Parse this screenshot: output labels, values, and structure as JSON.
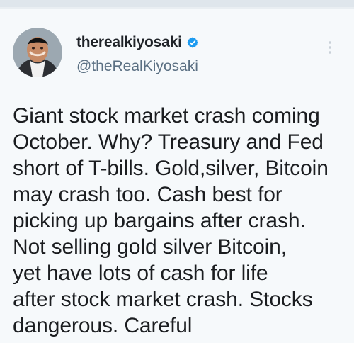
{
  "tweet": {
    "display_name": "therealkiyosaki",
    "handle": "@theRealKiyosaki",
    "verified": true,
    "text_lines": [
      "Giant stock market crash coming",
      "October. Why?  Treasury and Fed",
      "short of T-bills. Gold,silver, Bitcoin",
      "may crash too. Cash best for",
      "picking up bargains after crash.",
      "Not selling gold silver Bitcoin,",
      "yet have lots of cash for life",
      "after stock market crash. Stocks",
      "dangerous. Careful"
    ]
  },
  "icons": {
    "verified": "verified-badge-icon",
    "more": "more-options-icon"
  },
  "colors": {
    "accent": "#1d9bf0",
    "text": "#1b1d20",
    "handle": "#5b7083",
    "background": "#f6f9fb"
  }
}
